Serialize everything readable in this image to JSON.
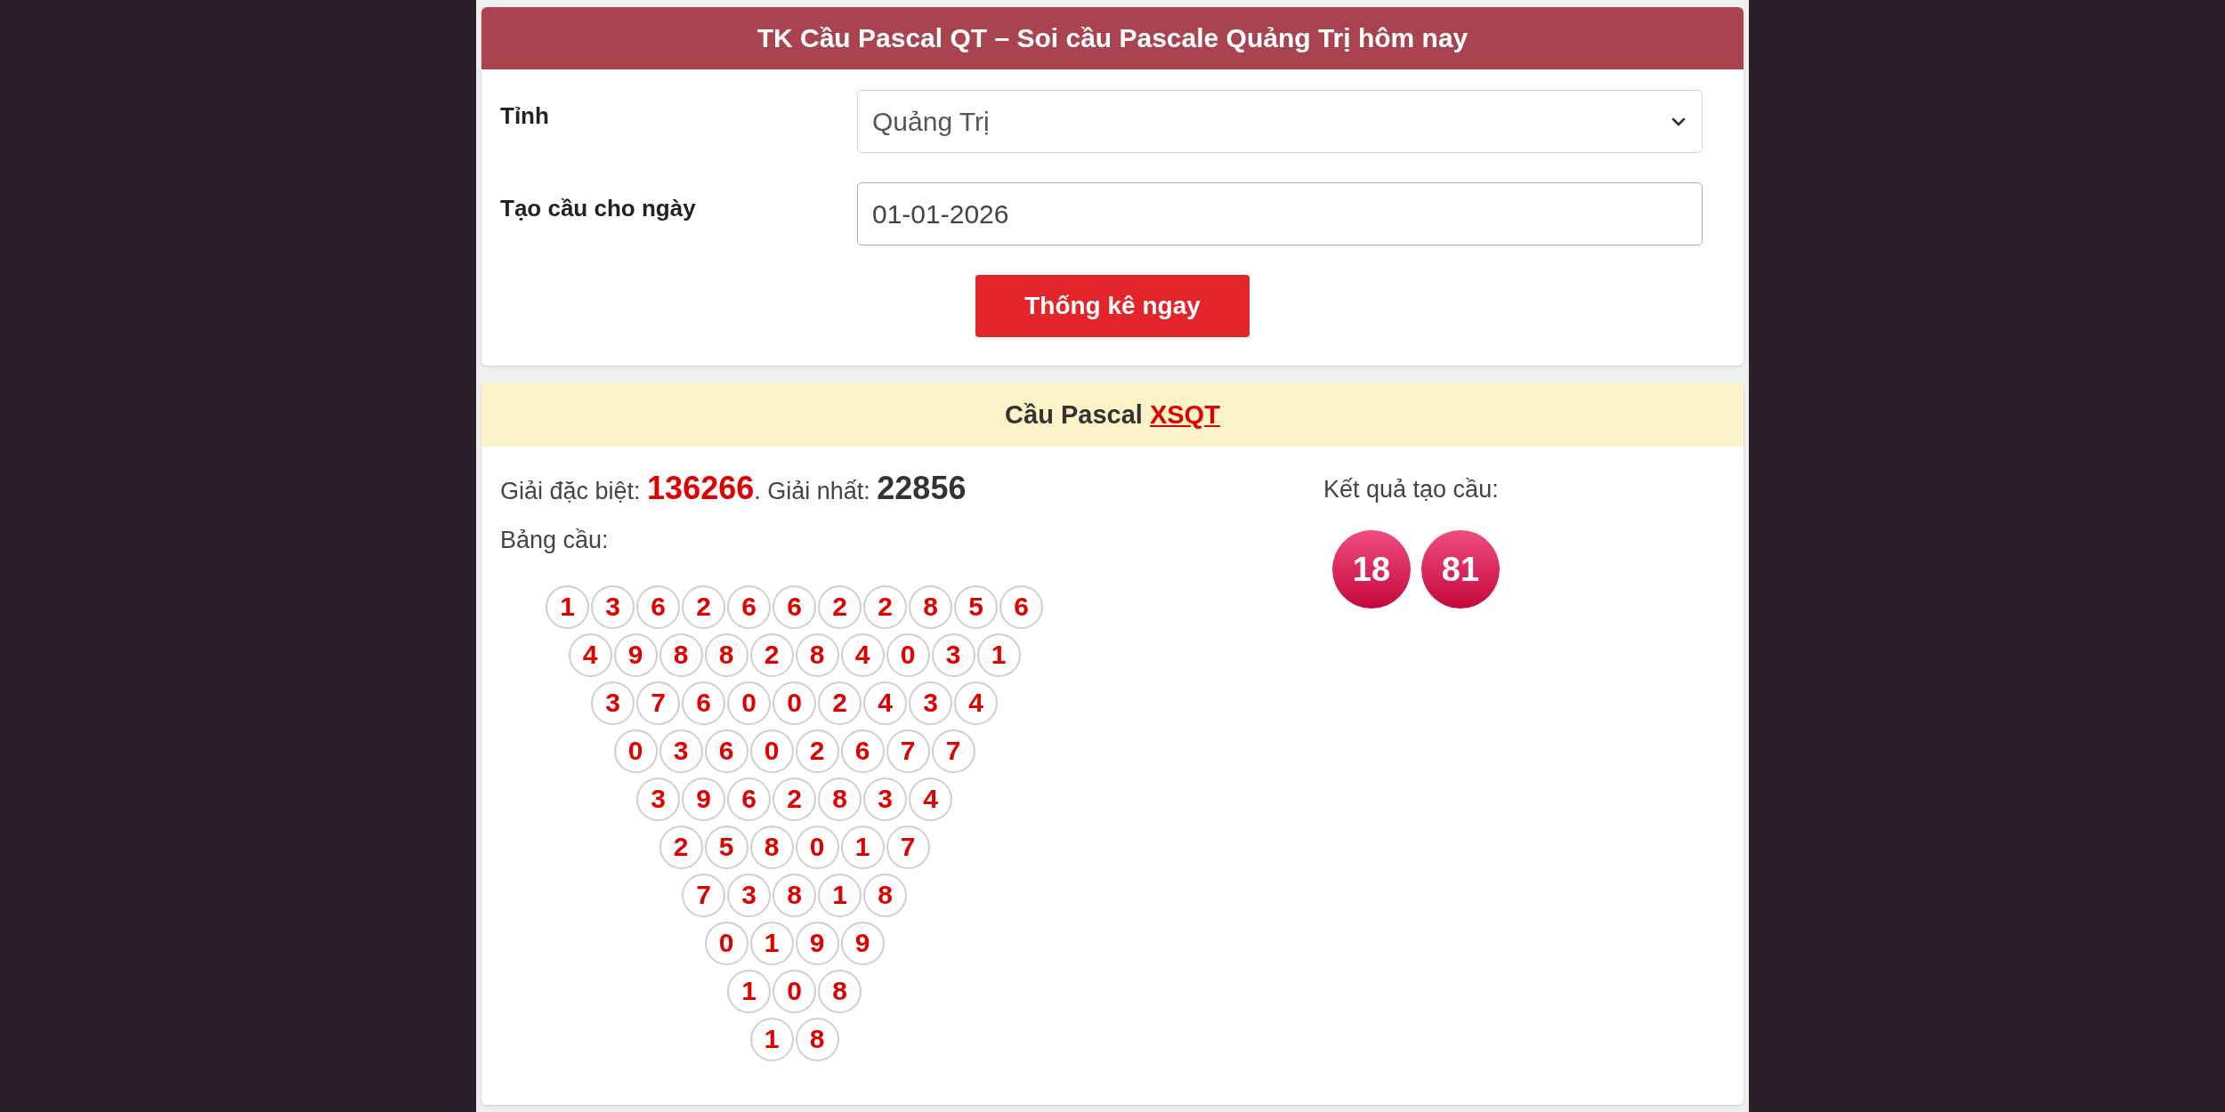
{
  "form_card": {
    "title": "TK Cầu Pascal QT – Soi cầu Pascale Quảng Trị hôm nay",
    "fields": [
      {
        "kind": "select",
        "label": "Tỉnh",
        "value": "Quảng Trị"
      },
      {
        "kind": "date",
        "label": "Tạo cầu cho ngày",
        "value": "01-01-2026"
      }
    ],
    "submit_button": "Thống kê ngay"
  },
  "result_card": {
    "title": "Cầu Pascal",
    "title_link": "XSQT",
    "prizes_line": "Giải đặc biệt: **136266**. Giải nhất: **22856**",
    "table_label": "Bảng cầu:",
    "pascal_rows": [
      [
        "1",
        "3",
        "6",
        "2",
        "6",
        "6",
        "2",
        "2",
        "8",
        "5",
        "6"
      ],
      [
        "4",
        "9",
        "8",
        "8",
        "2",
        "8",
        "4",
        "0",
        "3",
        "1"
      ],
      [
        "3",
        "7",
        "6",
        "0",
        "0",
        "2",
        "4",
        "3",
        "4"
      ],
      [
        "0",
        "3",
        "6",
        "0",
        "2",
        "6",
        "7",
        "7"
      ],
      [
        "3",
        "9",
        "6",
        "2",
        "8",
        "3",
        "4"
      ],
      [
        "2",
        "5",
        "8",
        "0",
        "1",
        "7"
      ],
      [
        "7",
        "3",
        "8",
        "1",
        "8"
      ],
      [
        "0",
        "1",
        "9",
        "9"
      ],
      [
        "1",
        "0",
        "8"
      ],
      [
        "1",
        "8"
      ]
    ],
    "result_label": "Kết quả tạo cầu:",
    "result_numbers": [
      "18",
      "81"
    ]
  }
}
